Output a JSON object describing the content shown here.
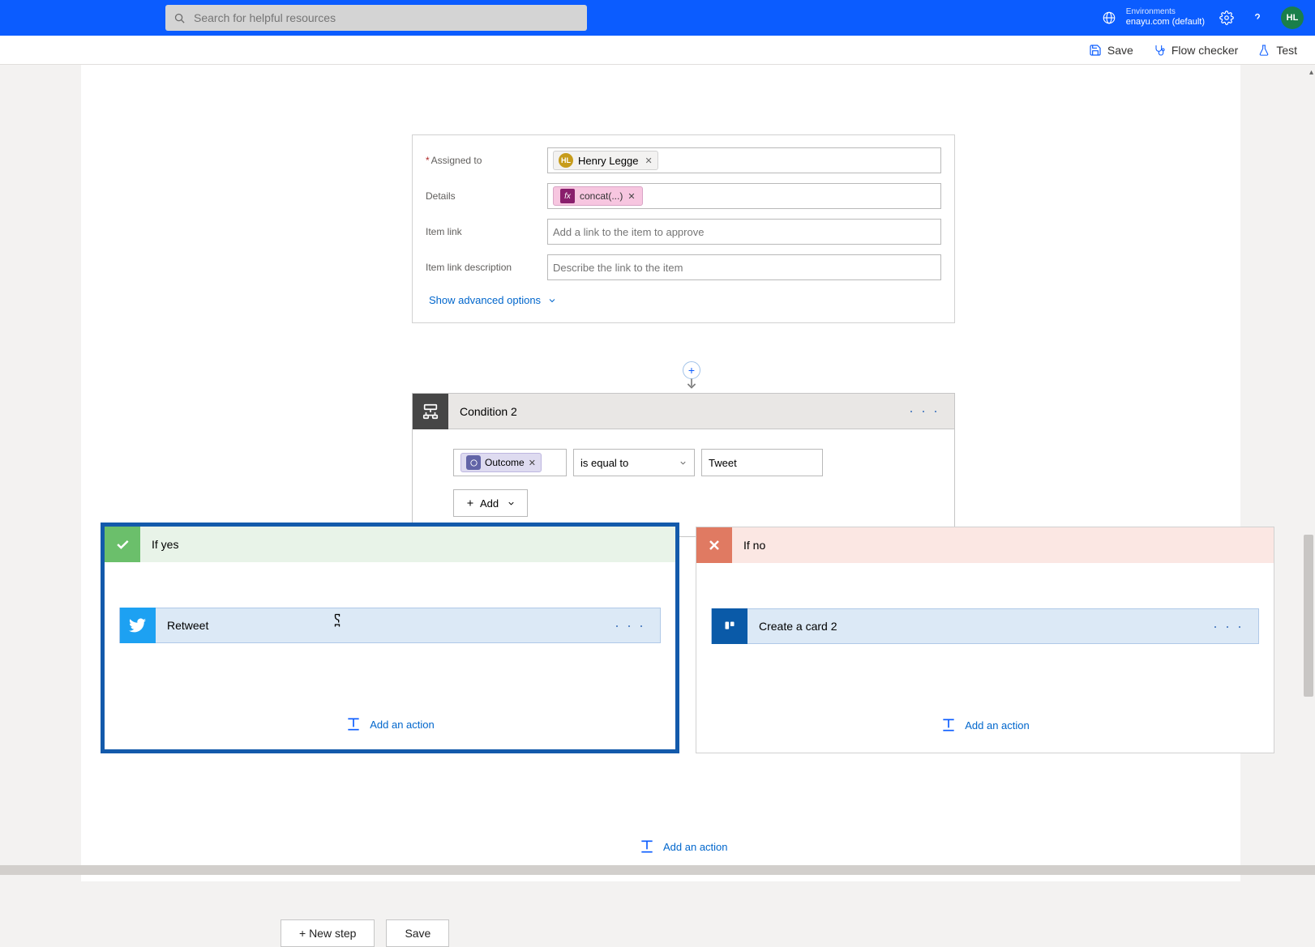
{
  "topbar": {
    "search_placeholder": "Search for helpful resources",
    "env_label": "Environments",
    "env_value": "enayu.com (default)",
    "avatar_initials": "HL"
  },
  "cmd": {
    "save": "Save",
    "flow_checker": "Flow checker",
    "test": "Test"
  },
  "approval": {
    "assigned_to_label": "Assigned to",
    "assigned_to_person": "Henry Legge",
    "details_label": "Details",
    "details_fx": "concat(...)",
    "item_link_label": "Item link",
    "item_link_placeholder": "Add a link to the item to approve",
    "item_link_desc_label": "Item link description",
    "item_link_desc_placeholder": "Describe the link to the item",
    "show_advanced": "Show advanced options"
  },
  "condition": {
    "title": "Condition 2",
    "left_token": "Outcome",
    "operator": "is equal to",
    "right_value": "Tweet",
    "add_label": "Add"
  },
  "branches": {
    "yes_title": "If yes",
    "no_title": "If no",
    "retweet_title": "Retweet",
    "create_card_title": "Create a card 2",
    "add_action": "Add an action"
  },
  "footer": {
    "new_step": "+ New step",
    "save": "Save"
  }
}
